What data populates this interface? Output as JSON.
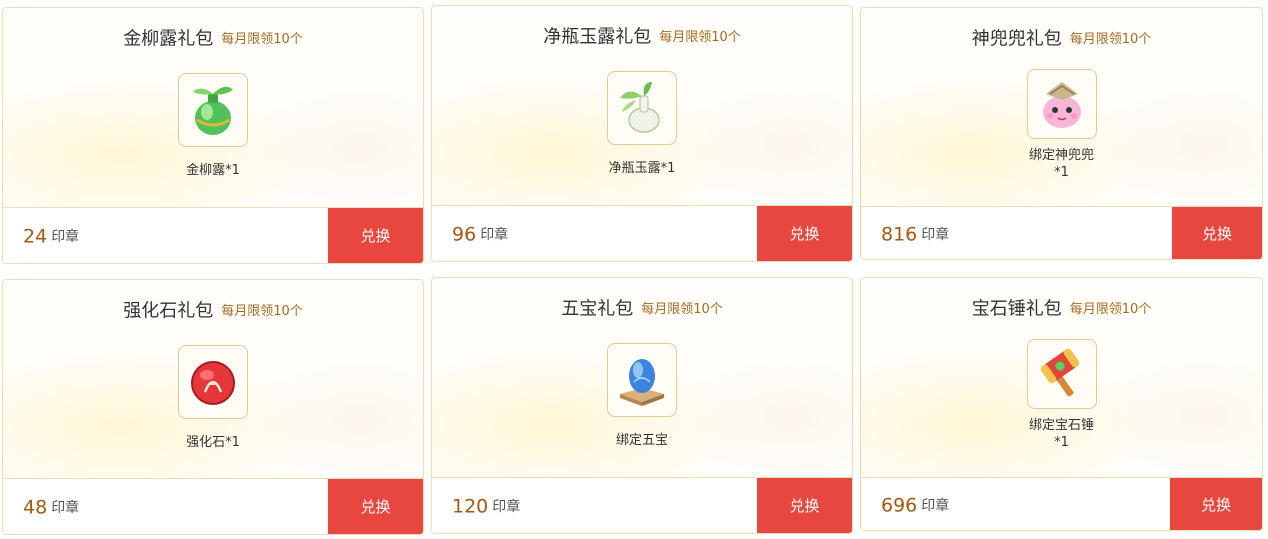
{
  "cards": [
    {
      "name": "金柳露礼包",
      "limit": "每月限领10个",
      "item_line1": "金柳露*1",
      "item_line2": "",
      "icon": "green-potion-icon",
      "price": "24",
      "unit": "印章",
      "button": "兑换"
    },
    {
      "name": "净瓶玉露礼包",
      "limit": "每月限领10个",
      "item_line1": "净瓶玉露*1",
      "item_line2": "",
      "icon": "white-vase-icon",
      "price": "96",
      "unit": "印章",
      "button": "兑换"
    },
    {
      "name": "神兜兜礼包",
      "limit": "每月限领10个",
      "item_line1": "绑定神兜兜",
      "item_line2": "*1",
      "icon": "pink-pouch-icon",
      "price": "816",
      "unit": "印章",
      "button": "兑换"
    },
    {
      "name": "强化石礼包",
      "limit": "每月限领10个",
      "item_line1": "强化石*1",
      "item_line2": "",
      "icon": "red-stone-icon",
      "price": "48",
      "unit": "印章",
      "button": "兑换"
    },
    {
      "name": "五宝礼包",
      "limit": "每月限领10个",
      "item_line1": "绑定五宝",
      "item_line2": "",
      "icon": "blue-gem-icon",
      "price": "120",
      "unit": "印章",
      "button": "兑换"
    },
    {
      "name": "宝石锤礼包",
      "limit": "每月限领10个",
      "item_line1": "绑定宝石锤",
      "item_line2": "*1",
      "icon": "gem-hammer-icon",
      "price": "696",
      "unit": "印章",
      "button": "兑换"
    }
  ],
  "colors": {
    "button": "#e8473f",
    "price": "#a05a14",
    "limit": "#a86a1e",
    "border": "#f1dcb8"
  }
}
